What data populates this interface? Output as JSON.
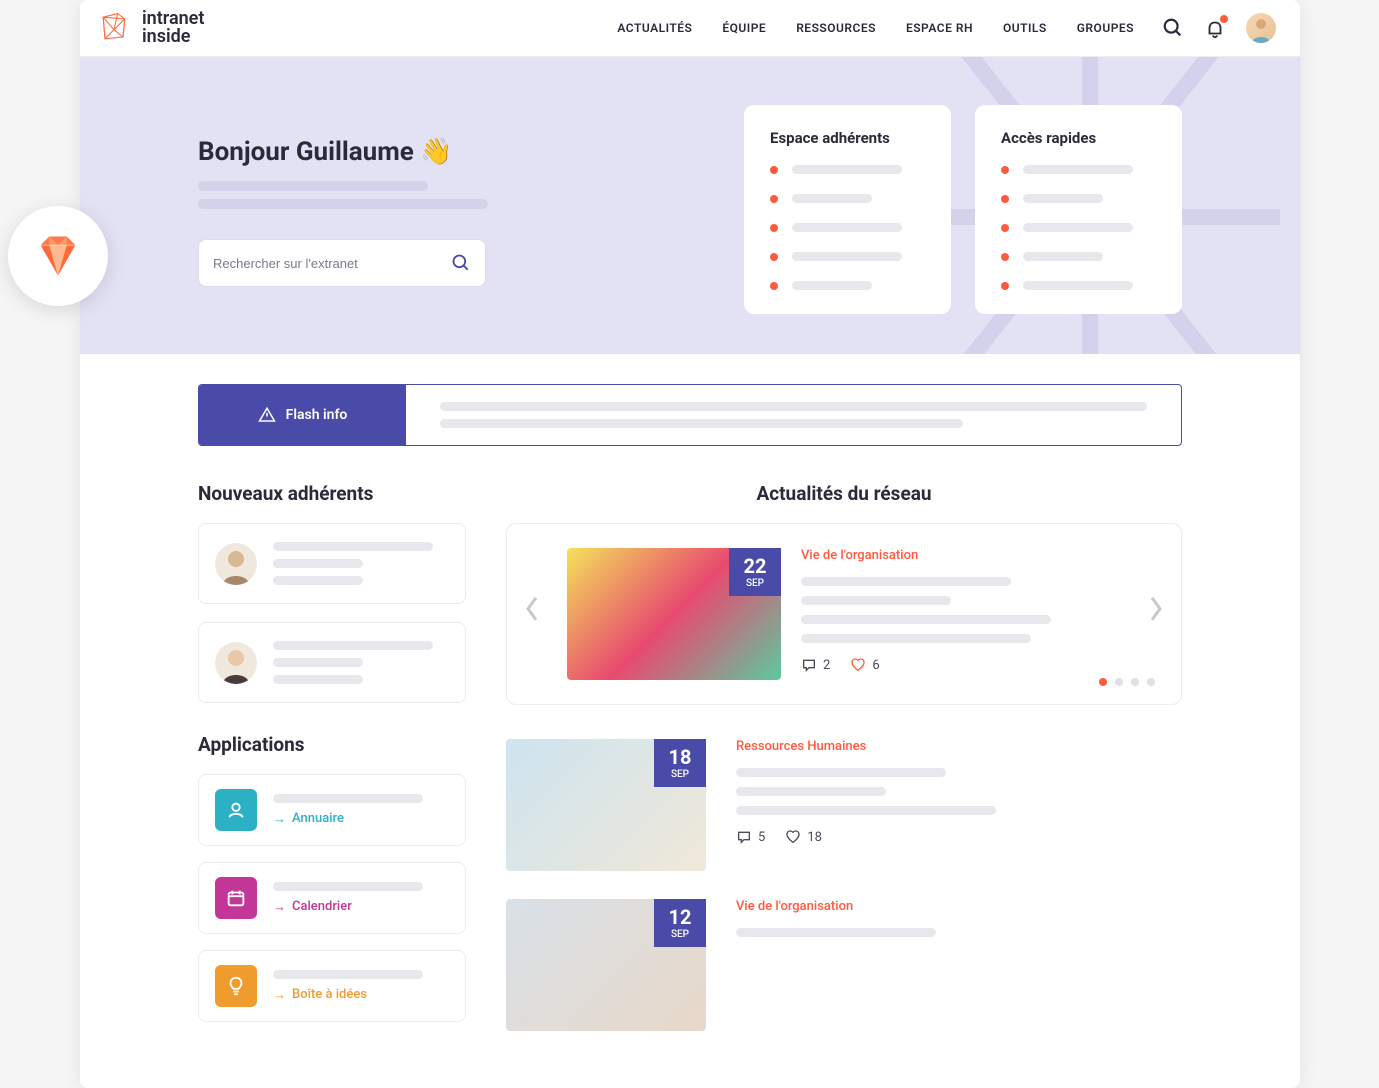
{
  "brand": {
    "name1": "intranet",
    "name2": "inside"
  },
  "nav": {
    "items": [
      "ACTUALITÉS",
      "ÉQUIPE",
      "RESSOURCES",
      "ESPACE RH",
      "OUTILS",
      "GROUPES"
    ]
  },
  "hero": {
    "greeting": "Bonjour Guillaume 👋",
    "search_placeholder": "Rechercher sur l'extranet",
    "card1_title": "Espace adhérents",
    "card2_title": "Accès rapides"
  },
  "flash": {
    "label": "Flash info"
  },
  "sections": {
    "members": "Nouveaux adhérents",
    "apps": "Applications",
    "news": "Actualités du réseau"
  },
  "apps": [
    {
      "label": "Annuaire",
      "color": "#2bb0c4",
      "link_class": "teal",
      "icon": "user"
    },
    {
      "label": "Calendrier",
      "color": "#c33799",
      "link_class": "magenta",
      "icon": "calendar"
    },
    {
      "label": "Boîte à idées",
      "color": "#f09b2e",
      "link_class": "orange",
      "icon": "bulb"
    }
  ],
  "news": [
    {
      "day": "22",
      "month": "SEP",
      "category": "Vie de l'organisation",
      "comments": 2,
      "likes": 6
    },
    {
      "day": "18",
      "month": "SEP",
      "category": "Ressources Humaines",
      "comments": 5,
      "likes": 18
    },
    {
      "day": "12",
      "month": "SEP",
      "category": "Vie de l'organisation",
      "comments": null,
      "likes": null
    }
  ],
  "colors": {
    "primary": "#4a4ba8",
    "accent": "#ff5a3c"
  }
}
